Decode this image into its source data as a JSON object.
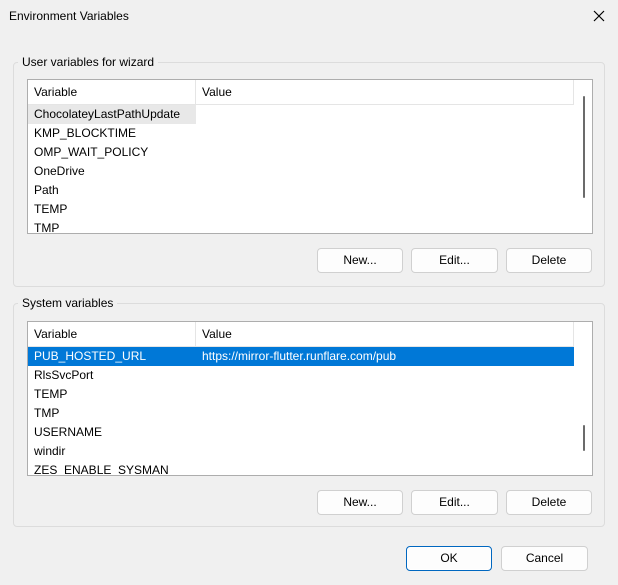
{
  "window": {
    "title": "Environment Variables"
  },
  "user_section": {
    "label": "User variables for wizard",
    "headers": {
      "variable": "Variable",
      "value": "Value"
    },
    "rows": [
      {
        "variable": "ChocolateyLastPathUpdate",
        "value": ""
      },
      {
        "variable": "KMP_BLOCKTIME",
        "value": ""
      },
      {
        "variable": "OMP_WAIT_POLICY",
        "value": ""
      },
      {
        "variable": "OneDrive",
        "value": ""
      },
      {
        "variable": "Path",
        "value": ""
      },
      {
        "variable": "TEMP",
        "value": ""
      },
      {
        "variable": "TMP",
        "value": ""
      }
    ],
    "buttons": {
      "new": "New...",
      "edit": "Edit...",
      "delete": "Delete"
    }
  },
  "system_section": {
    "label": "System variables",
    "headers": {
      "variable": "Variable",
      "value": "Value"
    },
    "rows": [
      {
        "variable": "PUB_HOSTED_URL",
        "value": "https://mirror-flutter.runflare.com/pub"
      },
      {
        "variable": "RlsSvcPort",
        "value": ""
      },
      {
        "variable": "TEMP",
        "value": ""
      },
      {
        "variable": "TMP",
        "value": ""
      },
      {
        "variable": "USERNAME",
        "value": ""
      },
      {
        "variable": "windir",
        "value": ""
      },
      {
        "variable": "ZES_ENABLE_SYSMAN",
        "value": ""
      }
    ],
    "buttons": {
      "new": "New...",
      "edit": "Edit...",
      "delete": "Delete"
    }
  },
  "footer": {
    "ok": "OK",
    "cancel": "Cancel"
  },
  "icons": {
    "close": "close-icon"
  },
  "colors": {
    "selection": "#0078d7",
    "hover": "#e8e8e8",
    "background": "#f0f0f0"
  }
}
